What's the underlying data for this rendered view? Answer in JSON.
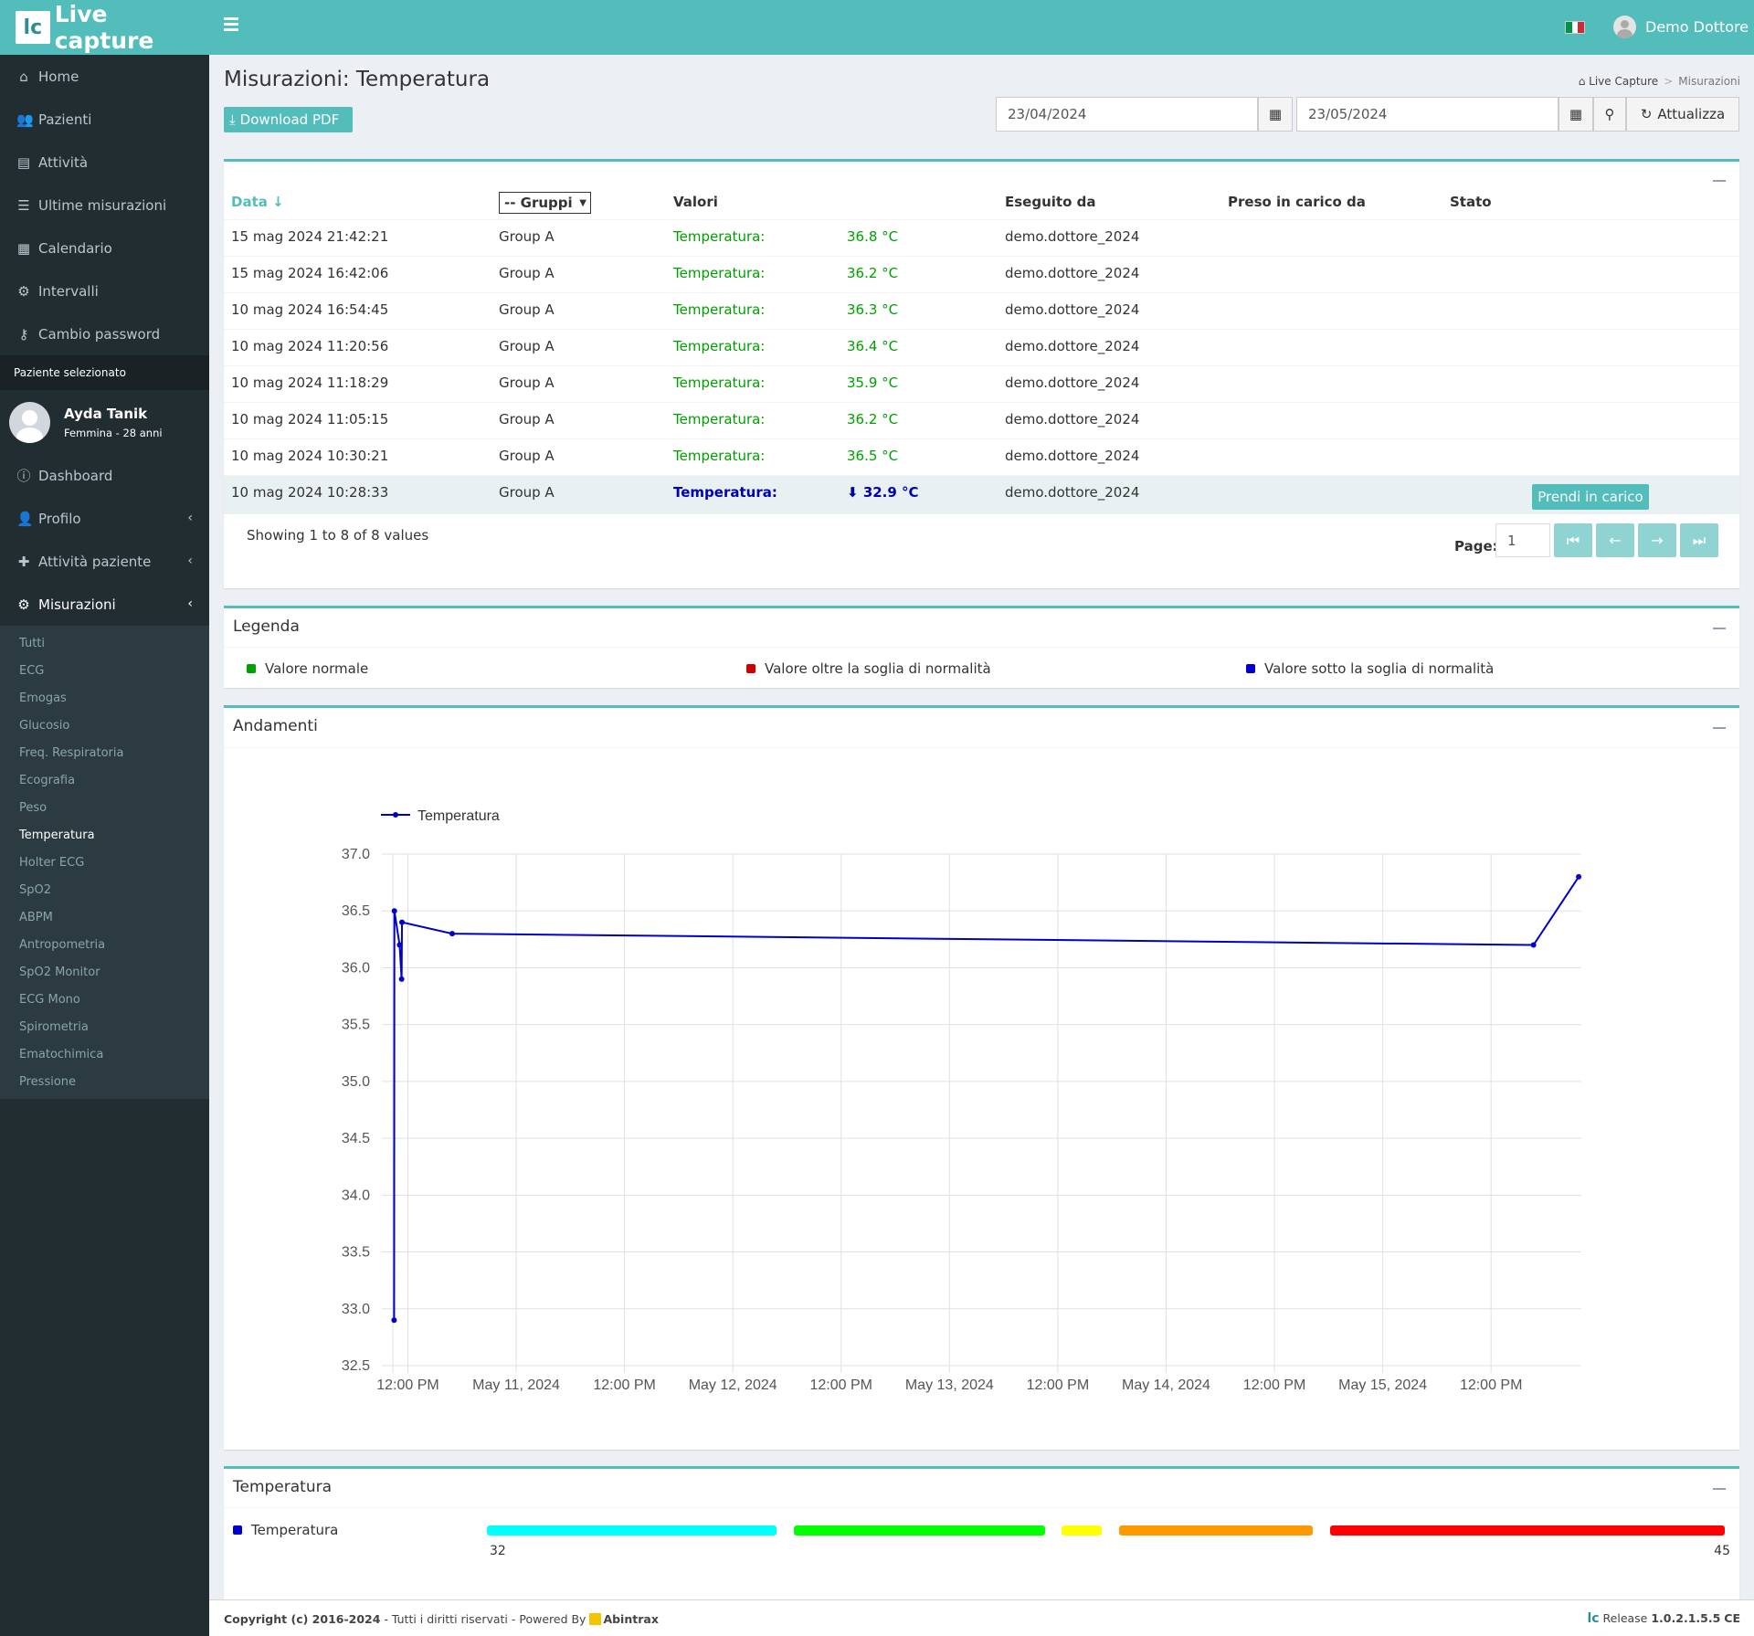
{
  "app": {
    "brand_logo": "lc",
    "brand_name": "Live capture"
  },
  "topbar": {
    "user_name": "Demo Dottore",
    "flag_colors": [
      "#009246",
      "#ffffff",
      "#ce2b37"
    ]
  },
  "sidebar": {
    "items": [
      {
        "label": "Home",
        "icon": "home-icon"
      },
      {
        "label": "Pazienti",
        "icon": "users-icon"
      },
      {
        "label": "Attività",
        "icon": "list-alt-icon"
      },
      {
        "label": "Ultime misurazioni",
        "icon": "list-icon"
      },
      {
        "label": "Calendario",
        "icon": "calendar-icon"
      },
      {
        "label": "Intervalli",
        "icon": "gear-icon"
      },
      {
        "label": "Cambio password",
        "icon": "key-icon"
      }
    ],
    "selected_header": "Paziente selezionato",
    "patient": {
      "name": "Ayda Tanik",
      "info": "Femmina - 28 anni"
    },
    "patient_items": [
      {
        "label": "Dashboard",
        "icon": "info-icon"
      },
      {
        "label": "Profilo",
        "icon": "user-icon"
      },
      {
        "label": "Attività paziente",
        "icon": "medkit-icon"
      },
      {
        "label": "Misurazioni",
        "icon": "gear-icon"
      }
    ],
    "submenu": [
      "Tutti",
      "ECG",
      "Emogas",
      "Glucosio",
      "Freq. Respiratoria",
      "Ecografia",
      "Peso",
      "Temperatura",
      "Holter ECG",
      "SpO2",
      "ABPM",
      "Antropometria",
      "SpO2 Monitor",
      "ECG Mono",
      "Spirometria",
      "Ematochimica",
      "Pressione"
    ],
    "submenu_active": "Temperatura"
  },
  "page": {
    "title": "Misurazioni: Temperatura",
    "breadcrumb": [
      "Live Capture",
      "Misurazioni"
    ],
    "download_label": "Download PDF",
    "date_from": "23/04/2024",
    "date_to": "23/05/2024",
    "refresh_label": "Attualizza"
  },
  "table": {
    "headers": {
      "date": "Data",
      "groups": "-- Gruppi",
      "values": "Valori",
      "by": "Eseguito da",
      "taken": "Preso in carico da",
      "state": "Stato"
    },
    "rows": [
      {
        "date": "15 mag 2024 21:42:21",
        "group": "Group A",
        "label": "Temperatura:",
        "value": "36.8 °C",
        "by": "demo.dottore_2024",
        "status": "normal"
      },
      {
        "date": "15 mag 2024 16:42:06",
        "group": "Group A",
        "label": "Temperatura:",
        "value": "36.2 °C",
        "by": "demo.dottore_2024",
        "status": "normal"
      },
      {
        "date": "10 mag 2024 16:54:45",
        "group": "Group A",
        "label": "Temperatura:",
        "value": "36.3 °C",
        "by": "demo.dottore_2024",
        "status": "normal"
      },
      {
        "date": "10 mag 2024 11:20:56",
        "group": "Group A",
        "label": "Temperatura:",
        "value": "36.4 °C",
        "by": "demo.dottore_2024",
        "status": "normal"
      },
      {
        "date": "10 mag 2024 11:18:29",
        "group": "Group A",
        "label": "Temperatura:",
        "value": "35.9 °C",
        "by": "demo.dottore_2024",
        "status": "normal"
      },
      {
        "date": "10 mag 2024 11:05:15",
        "group": "Group A",
        "label": "Temperatura:",
        "value": "36.2 °C",
        "by": "demo.dottore_2024",
        "status": "normal"
      },
      {
        "date": "10 mag 2024 10:30:21",
        "group": "Group A",
        "label": "Temperatura:",
        "value": "36.5 °C",
        "by": "demo.dottore_2024",
        "status": "normal"
      },
      {
        "date": "10 mag 2024 10:28:33",
        "group": "Group A",
        "label": "Temperatura:",
        "value": "32.9 °C",
        "by": "demo.dottore_2024",
        "status": "low",
        "action": "Prendi in carico"
      }
    ],
    "showing": "Showing 1 to 8 of 8 values",
    "page_label": "Page:",
    "page_value": "1"
  },
  "legend": {
    "title": "Legenda",
    "items": [
      {
        "label": "Valore normale",
        "color": "#00a000"
      },
      {
        "label": "Valore oltre la soglia di normalità",
        "color": "#d00000"
      },
      {
        "label": "Valore sotto la soglia di normalità",
        "color": "#0000c8"
      }
    ]
  },
  "trends": {
    "title": "Andamenti"
  },
  "chart_data": {
    "type": "line",
    "title": "",
    "xlabel": "",
    "ylabel": "",
    "ylim": [
      32.5,
      37.0
    ],
    "y_ticks": [
      "37.0",
      "36.5",
      "36.0",
      "35.5",
      "35.0",
      "34.5",
      "34.0",
      "33.5",
      "33.0",
      "32.5"
    ],
    "x_ticks": [
      "12:00 PM",
      "May 11, 2024",
      "12:00 PM",
      "May 12, 2024",
      "12:00 PM",
      "May 13, 2024",
      "12:00 PM",
      "May 14, 2024",
      "12:00 PM",
      "May 15, 2024",
      "12:00 PM"
    ],
    "x_tick_times": [
      "2024-05-10 12:00",
      "2024-05-11 00:00",
      "2024-05-11 12:00",
      "2024-05-12 00:00",
      "2024-05-12 12:00",
      "2024-05-13 00:00",
      "2024-05-13 12:00",
      "2024-05-14 00:00",
      "2024-05-14 12:00",
      "2024-05-15 00:00",
      "2024-05-15 12:00"
    ],
    "xlim": [
      "2024-05-10 10:20",
      "2024-05-15 22:00"
    ],
    "grid": true,
    "legend_position": "top-left",
    "series": [
      {
        "name": "Temperatura",
        "color": "#0000c8",
        "points": [
          {
            "x": "2024-05-10 10:28:33",
            "y": 32.9
          },
          {
            "x": "2024-05-10 10:30:21",
            "y": 36.5
          },
          {
            "x": "2024-05-10 11:05:15",
            "y": 36.2
          },
          {
            "x": "2024-05-10 11:18:29",
            "y": 35.9
          },
          {
            "x": "2024-05-10 11:20:56",
            "y": 36.4
          },
          {
            "x": "2024-05-10 16:54:45",
            "y": 36.3
          },
          {
            "x": "2024-05-15 16:42:06",
            "y": 36.2
          },
          {
            "x": "2024-05-15 21:42:21",
            "y": 36.8
          }
        ]
      }
    ]
  },
  "range": {
    "title": "Temperatura",
    "label": "Temperatura",
    "dot_color": "#0000c8",
    "min_label": "32",
    "max_label": "45",
    "segments": [
      {
        "color": "#00ffff",
        "from": 32,
        "to": 35.1
      },
      {
        "color": "#00ff00",
        "from": 35.2,
        "to": 37.9
      },
      {
        "color": "#ffff00",
        "from": 38.0,
        "to": 38.5
      },
      {
        "color": "#ff9900",
        "from": 38.6,
        "to": 40.7
      },
      {
        "color": "#ff0000",
        "from": 40.8,
        "to": 45
      }
    ]
  },
  "footer": {
    "copyright": "Copyright (c) 2016-2024",
    "rights": " - Tutti i diritti riservati - Powered By ",
    "powered": "Abintrax",
    "release_label": "Release",
    "release_version": "1.0.2.1.5.5",
    "ce": "CE"
  }
}
